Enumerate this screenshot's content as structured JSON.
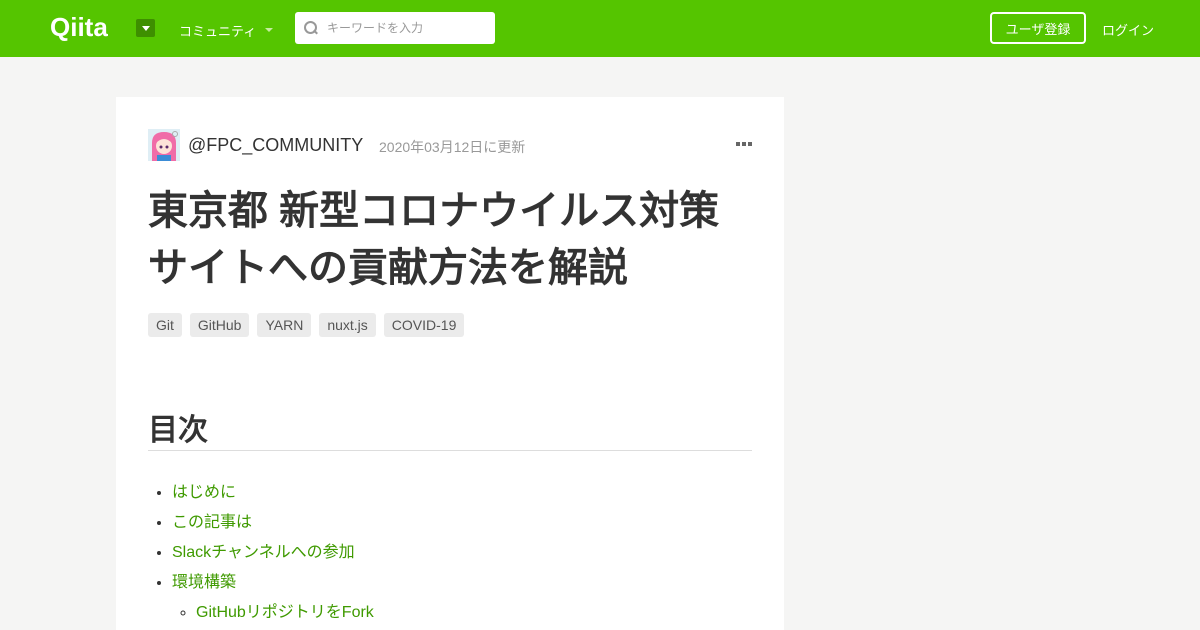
{
  "header": {
    "logo_text": "Qiita",
    "community_label": "コミュニティ",
    "search_placeholder": "キーワードを入力",
    "signup_label": "ユーザ登録",
    "login_label": "ログイン",
    "brand_color": "#55c500"
  },
  "article": {
    "author": "@FPC_COMMUNITY",
    "updated": "2020年03月12日に更新",
    "title_line1": "東京都 新型コロナウイルス対策",
    "title_line2": "サイトへの貢献方法を解説",
    "tags": [
      "Git",
      "GitHub",
      "YARN",
      "nuxt.js",
      "COVID-19"
    ]
  },
  "toc": {
    "heading": "目次",
    "items": [
      "はじめに",
      "この記事は",
      "Slackチャンネルへの参加",
      "環境構築"
    ],
    "sub_items": [
      "GitHubリポジトリをFork"
    ]
  },
  "icons": {
    "search": "search-icon",
    "more": "more-dots-icon",
    "dropdown": "caret-down-icon"
  }
}
